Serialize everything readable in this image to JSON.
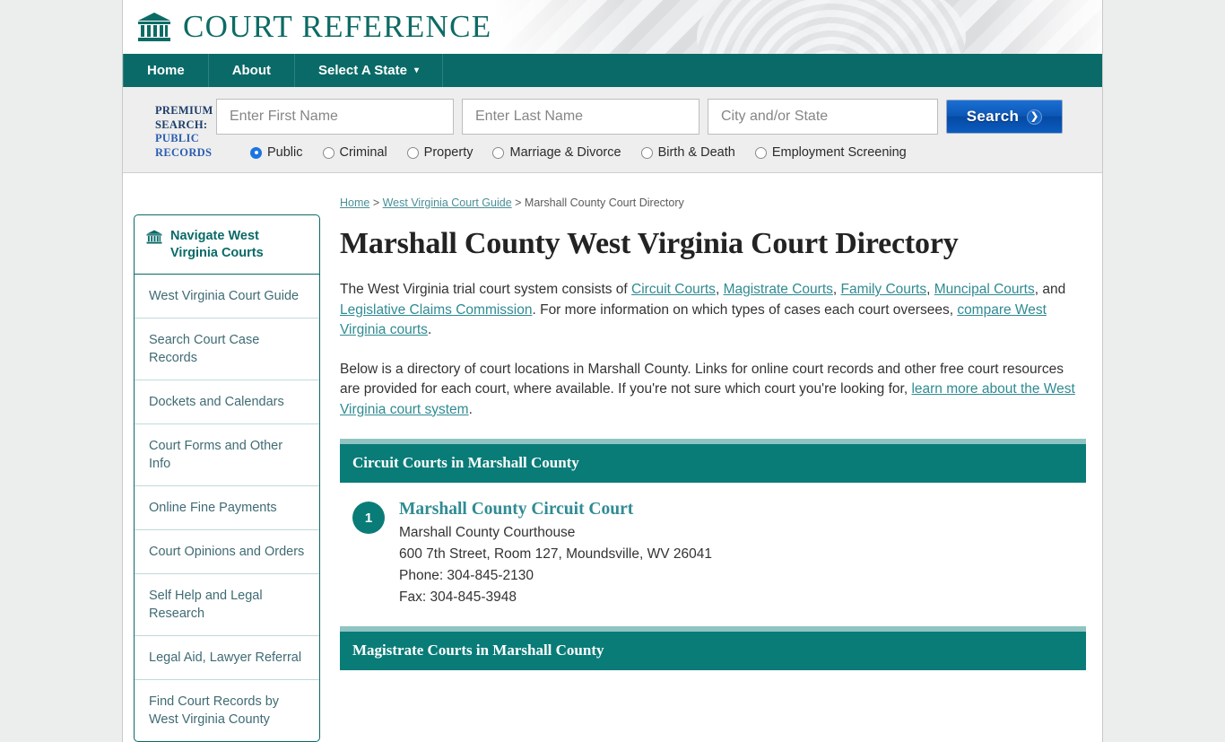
{
  "site": {
    "brand_title": "COURT REFERENCE",
    "brand_icon": "courthouse-icon"
  },
  "nav": {
    "items": [
      {
        "label": "Home",
        "caret": ""
      },
      {
        "label": "About",
        "caret": ""
      },
      {
        "label": "Select A State",
        "caret": "▾"
      }
    ]
  },
  "premium_search": {
    "label_line1": "PREMIUM",
    "label_line2": "SEARCH:",
    "label_line3": "PUBLIC",
    "label_line4": "RECORDS",
    "first_name_placeholder": "Enter First Name",
    "first_name_value": "",
    "last_name_placeholder": "Enter Last Name",
    "last_name_value": "",
    "city_state_placeholder": "City and/or State",
    "city_state_value": "",
    "search_button": "Search",
    "search_button_icon": "chevron-right-icon",
    "radios": [
      {
        "label": "Public",
        "selected": true
      },
      {
        "label": "Criminal",
        "selected": false
      },
      {
        "label": "Property",
        "selected": false
      },
      {
        "label": "Marriage & Divorce",
        "selected": false
      },
      {
        "label": "Birth & Death",
        "selected": false
      },
      {
        "label": "Employment Screening",
        "selected": false
      }
    ]
  },
  "sidebar": {
    "header": "Navigate West Virginia Courts",
    "header_icon": "courthouse-icon",
    "items": [
      {
        "label": "West Virginia Court Guide"
      },
      {
        "label": "Search Court Case Records"
      },
      {
        "label": "Dockets and Calendars"
      },
      {
        "label": "Court Forms and Other Info"
      },
      {
        "label": "Online Fine Payments"
      },
      {
        "label": "Court Opinions and Orders"
      },
      {
        "label": "Self Help and Legal Research"
      },
      {
        "label": "Legal Aid, Lawyer Referral"
      },
      {
        "label": "Find Court Records by West Virginia County"
      }
    ]
  },
  "breadcrumb": {
    "home": "Home",
    "sep1": " > ",
    "guide": "West Virginia Court Guide",
    "sep2": " > ",
    "current": "Marshall County Court Directory"
  },
  "main": {
    "title": "Marshall County West Virginia Court Directory",
    "paragraph1": {
      "t1": "The West Virginia trial court system consists of ",
      "link1": "Circuit Courts",
      "t2": ", ",
      "link2": "Magistrate Courts",
      "t3": ", ",
      "link3": "Family Courts",
      "t4": ", ",
      "link4": "Muncipal Courts",
      "t5": ", and ",
      "link5": "Legislative Claims Commission",
      "t6": ". For more information on which types of cases each court oversees, ",
      "link6": "compare West Virginia courts",
      "t7": "."
    },
    "paragraph2": {
      "t1": "Below is a directory of court locations in Marshall County. Links for online court records and other free court resources are provided for each court, where available. If you're not sure which court you're looking for, ",
      "link1": "learn more about the West Virginia court system",
      "t2": "."
    },
    "sections": [
      {
        "heading": "Circuit Courts in Marshall County",
        "courts": [
          {
            "number": "1",
            "name": "Marshall County Circuit Court",
            "building": "Marshall County Courthouse",
            "address": "600 7th Street, Room 127, Moundsville, WV 26041",
            "phone": "Phone: 304-845-2130",
            "fax": "Fax: 304-845-3948"
          }
        ]
      },
      {
        "heading": "Magistrate Courts in Marshall County",
        "courts": []
      }
    ]
  },
  "colors": {
    "teal": "#0a6a67",
    "teal_section": "#0a7c78",
    "teal_light": "#8fc4c2",
    "link": "#2f8b93",
    "blue_button": "#0d57b5",
    "navy": "#1d3d68",
    "blue": "#2a5db0"
  }
}
